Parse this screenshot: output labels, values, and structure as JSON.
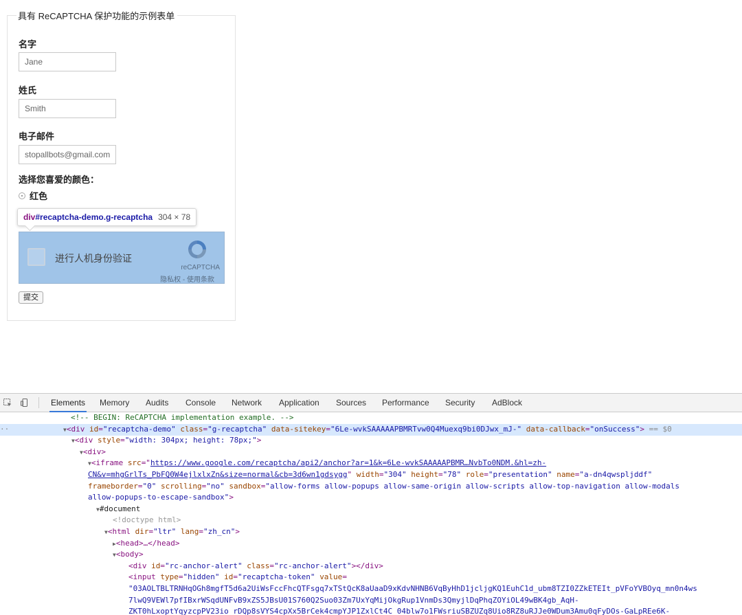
{
  "form": {
    "legend": "具有 ReCAPTCHA 保护功能的示例表单",
    "first_name_label": "名字",
    "first_name_value": "Jane",
    "last_name_label": "姓氏",
    "last_name_value": "Smith",
    "email_label": "电子邮件",
    "email_value": "stopallbots@gmail.com",
    "color_label": "选择您喜爱的颜色：",
    "color_option": "红色",
    "submit_label": "提交"
  },
  "tooltip": {
    "tag": "div",
    "selector": "#recaptcha-demo.g-recaptcha",
    "size": "304 × 78"
  },
  "captcha": {
    "checkbox_label": "进行人机身份验证",
    "brand": "reCAPTCHA",
    "terms": "隐私权 - 使用条款"
  },
  "devtools": {
    "tabs": [
      "Elements",
      "Memory",
      "Audits",
      "Console",
      "Network",
      "Application",
      "Sources",
      "Performance",
      "Security",
      "AdBlock"
    ],
    "active_tab": "Elements",
    "code": {
      "l0": "<!-- BEGIN: ReCAPTCHA implementation example. -->",
      "l1_attr1": "id",
      "l1_val1": "\"recaptcha-demo\"",
      "l1_attr2": "class",
      "l1_val2": "\"g-recaptcha\"",
      "l1_attr3": "data-sitekey",
      "l1_val3": "\"6Le-wvkSAAAAAPBMRTvw0Q4Muexq9bi0DJwx_mJ-\"",
      "l1_attr4": "data-callback",
      "l1_val4": "\"onSuccess\"",
      "l1_marker": "== $0",
      "l2_attr": "style",
      "l2_val": "\"width: 304px; height: 78px;\"",
      "l4_url_a": "https://www.google.com/recaptcha/api2/anchor?ar=1&k=6Le-wvkSAAAAAPBMR…NvbTo0NDM.&hl=zh-",
      "l5_url_b": "CN&v=mhgGrlTs_PbFQ0W4ejlxlxZn&size=normal&cb=3d6wn1gdsygg",
      "l5_attr1": "width",
      "l5_val1": "\"304\"",
      "l5_attr2": "height",
      "l5_val2": "\"78\"",
      "l5_attr3": "role",
      "l5_val3": "\"presentation\"",
      "l5_attr4": "name",
      "l5_val4": "\"a-dn4qwspljddf\"",
      "l6_attr1": "frameborder",
      "l6_val1": "\"0\"",
      "l6_attr2": "scrolling",
      "l6_val2": "\"no\"",
      "l6_attr3": "sandbox",
      "l6_val3a": "\"allow-forms allow-popups allow-same-origin allow-scripts allow-top-navigation allow-modals",
      "l7_val3b": "allow-popups-to-escape-sandbox\"",
      "l8": "#document",
      "l9": "<!doctype html>",
      "l10_attr1": "dir",
      "l10_val1": "\"ltr\"",
      "l10_attr2": "lang",
      "l10_val2": "\"zh_cn\"",
      "l11": "<head>…</head>",
      "l12": "<body>",
      "l13_attr1": "id",
      "l13_val1": "\"rc-anchor-alert\"",
      "l13_attr2": "class",
      "l13_val2": "\"rc-anchor-alert\"",
      "l14_attr1": "type",
      "l14_val1": "\"hidden\"",
      "l14_attr2": "id",
      "l14_val2": "\"recaptcha-token\"",
      "l14_attr3": "value",
      "l15": "\"03AOLTBLTRNHqOGh8mgfT5d6a2UiWsFccFhcQTFsgq7xTStQcK8aUaaD9xKdvNHNB6VqByHhD1jcljgKQ1EuhC1d_ubm8TZI0ZZkETEIt_pVFoYVBOyq_mn0n4ws",
      "l16": "7lwQ9VEWl7pfIBxrWSqdUNFvB9xZS5JBsU01S760Q2Suo03Zm7UxYqMijOkgRup1VnmDs3QmyjlDqPhqZOYiOL49wBK4gb_AqH-",
      "l17": "ZKT0hLxoptYqyzcpPV23io_rDQp8sVYS4cpXx5BrCek4cmpYJP1ZxlCt4C_04blw7o1FWsriuSBZUZq8Uio8RZ8uRJJe0WDum3Amu0qFyDOs-GaLpREe6K-"
    }
  }
}
